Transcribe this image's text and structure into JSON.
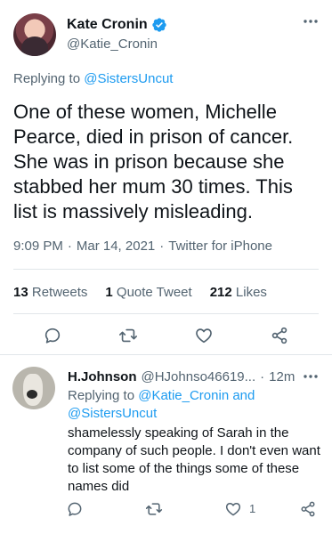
{
  "tweet": {
    "display_name": "Kate Cronin",
    "handle": "@Katie_Cronin",
    "replying_prefix": "Replying to",
    "replying_to": "@SistersUncut",
    "text": "One of these women, Michelle Pearce, died in prison of cancer. She was in prison because she stabbed her mum 30 times. This list is massively misleading.",
    "time": "9:09 PM",
    "date": "Mar 14, 2021",
    "source": "Twitter for iPhone",
    "separator": "·",
    "retweets_count": "13",
    "retweets_label": "Retweets",
    "quotes_count": "1",
    "quotes_label": "Quote Tweet",
    "likes_count": "212",
    "likes_label": "Likes"
  },
  "reply": {
    "display_name": "H.Johnson",
    "handle": "@HJohnso46619...",
    "separator": "·",
    "time": "12m",
    "replying_prefix": "Replying to",
    "replying_to_1": "@Katie_Cronin",
    "replying_and": "and",
    "replying_to_2": "@SistersUncut",
    "text": "shamelessly speaking of Sarah in the company of such people.  I don't even want to list some of the things some of these names did",
    "like_count": "1"
  },
  "icons": {
    "verified": "verified-badge-icon",
    "more": "more-dots-icon",
    "reply": "reply-bubble-icon",
    "retweet": "retweet-icon",
    "like": "heart-icon",
    "share": "share-icon"
  },
  "colors": {
    "accent": "#1d9bf0",
    "text": "#0f1419",
    "muted": "#536471",
    "divider": "#e1e6ea"
  }
}
